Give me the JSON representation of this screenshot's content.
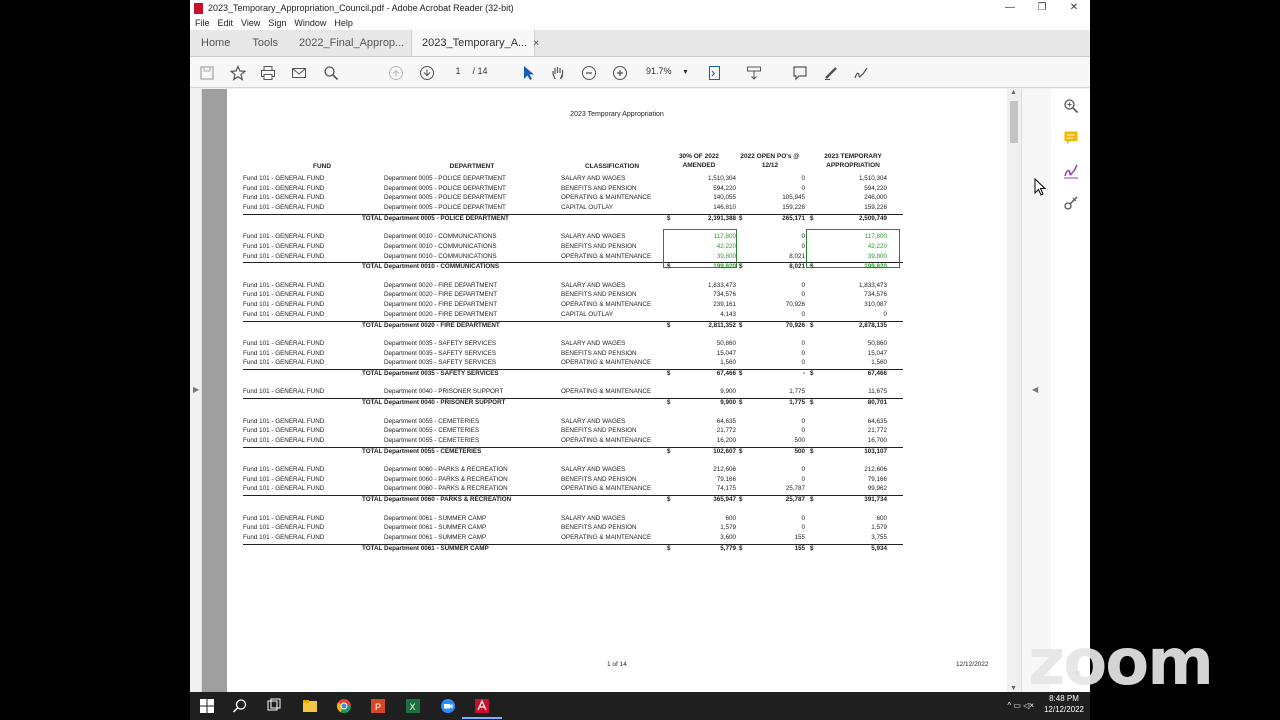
{
  "window": {
    "title": "2023_Temporary_Appropriation_Council.pdf - Adobe Acrobat Reader (32-bit)",
    "minimize": "—",
    "maximize": "❐",
    "close": "✕"
  },
  "menu": [
    "File",
    "Edit",
    "View",
    "Sign",
    "Window",
    "Help"
  ],
  "tabs": {
    "home": "Home",
    "tools": "Tools",
    "doc1": "2022_Final_Approp...",
    "doc2": "2023_Temporary_A...",
    "close": "×"
  },
  "toolbar": {
    "page_current": "1",
    "page_total": "/ 14",
    "zoom": "91.7%",
    "icons": [
      "save-icon",
      "bookmark-star-icon",
      "print-icon",
      "email-icon",
      "search-icon",
      "page-up-icon",
      "page-down-icon",
      "select-cursor-icon",
      "hand-icon",
      "zoom-out-icon",
      "zoom-in-icon",
      "fit-page-icon",
      "scroll-mode-icon",
      "comment-icon",
      "highlight-icon",
      "sign-icon"
    ]
  },
  "document": {
    "title": "2023 Temporary Appropriation",
    "headers": {
      "fund": "FUND",
      "department": "DEPARTMENT",
      "classification": "CLASSIFICATION",
      "v1_line1": "30% OF 2022",
      "v1_line2": "AMENDED",
      "v2_line1": "2022 OPEN PO's @",
      "v2_line2": "12/12",
      "v3_line1": "2023 TEMPORARY",
      "v3_line2": "APPROPRIATION"
    },
    "groups": [
      {
        "rows": [
          {
            "fund": "Fund  101 - GENERAL FUND",
            "dept": "Department  0005 - POLICE DEPARTMENT",
            "cls": "SALARY AND WAGES",
            "v1": "1,510,304",
            "v2": "0",
            "v3": "1,510,304"
          },
          {
            "fund": "Fund  101 - GENERAL FUND",
            "dept": "Department  0005 - POLICE DEPARTMENT",
            "cls": "BENEFITS AND PENSION",
            "v1": "594,220",
            "v2": "0",
            "v3": "594,220"
          },
          {
            "fund": "Fund  101 - GENERAL FUND",
            "dept": "Department  0005 - POLICE DEPARTMENT",
            "cls": "OPERATING & MAINTENANCE",
            "v1": "140,055",
            "v2": "105,945",
            "v3": "246,000"
          },
          {
            "fund": "Fund  101 - GENERAL FUND",
            "dept": "Department  0005 - POLICE DEPARTMENT",
            "cls": "CAPITAL OUTLAY",
            "v1": "146,810",
            "v2": "159,226",
            "v3": "159,226"
          }
        ],
        "total": {
          "label": "TOTAL Department  0005 - POLICE DEPARTMENT",
          "v1": "2,391,388",
          "v2": "265,171",
          "v3": "2,509,749"
        }
      },
      {
        "rows": [
          {
            "fund": "Fund  101 - GENERAL FUND",
            "dept": "Department  0010 - COMMUNICATIONS",
            "cls": "SALARY AND WAGES",
            "v1": "117,800",
            "v2": "0",
            "v3": "117,800"
          },
          {
            "fund": "Fund  101 - GENERAL FUND",
            "dept": "Department  0010 - COMMUNICATIONS",
            "cls": "BENEFITS AND PENSION",
            "v1": "42,220",
            "v2": "0",
            "v3": "42,220"
          },
          {
            "fund": "Fund  101 - GENERAL FUND",
            "dept": "Department  0010 - COMMUNICATIONS",
            "cls": "OPERATING & MAINTENANCE",
            "v1": "39,800",
            "v2": "8,021",
            "v3": "39,800"
          }
        ],
        "total": {
          "label": "TOTAL Department  0010 - COMMUNICATIONS",
          "v1": "199,820",
          "v2": "8,021",
          "v3": "199,820"
        }
      },
      {
        "rows": [
          {
            "fund": "Fund  101 - GENERAL FUND",
            "dept": "Department  0020 - FIRE DEPARTMENT",
            "cls": "SALARY AND WAGES",
            "v1": "1,833,473",
            "v2": "0",
            "v3": "1,833,473"
          },
          {
            "fund": "Fund  101 - GENERAL FUND",
            "dept": "Department  0020 - FIRE DEPARTMENT",
            "cls": "BENEFITS AND PENSION",
            "v1": "734,576",
            "v2": "0",
            "v3": "734,576"
          },
          {
            "fund": "Fund  101 - GENERAL FUND",
            "dept": "Department  0020 - FIRE DEPARTMENT",
            "cls": "OPERATING & MAINTENANCE",
            "v1": "239,161",
            "v2": "70,926",
            "v3": "310,087"
          },
          {
            "fund": "Fund  101 - GENERAL FUND",
            "dept": "Department  0020 - FIRE DEPARTMENT",
            "cls": "CAPITAL OUTLAY",
            "v1": "4,143",
            "v2": "0",
            "v3": "0"
          }
        ],
        "total": {
          "label": "TOTAL Department  0020 - FIRE DEPARTMENT",
          "v1": "2,811,352",
          "v2": "70,926",
          "v3": "2,878,135"
        }
      },
      {
        "rows": [
          {
            "fund": "Fund  101 - GENERAL FUND",
            "dept": "Department  0035 - SAFETY SERVICES",
            "cls": "SALARY AND WAGES",
            "v1": "50,860",
            "v2": "0",
            "v3": "50,860"
          },
          {
            "fund": "Fund  101 - GENERAL FUND",
            "dept": "Department  0035 - SAFETY SERVICES",
            "cls": "BENEFITS AND PENSION",
            "v1": "15,047",
            "v2": "0",
            "v3": "15,047"
          },
          {
            "fund": "Fund  101 - GENERAL FUND",
            "dept": "Department  0035 - SAFETY SERVICES",
            "cls": "OPERATING & MAINTENANCE",
            "v1": "1,560",
            "v2": "0",
            "v3": "1,560"
          }
        ],
        "total": {
          "label": "TOTAL Department  0035 - SAFETY SERVICES",
          "v1": "67,466",
          "v2": "-",
          "v3": "67,466"
        }
      },
      {
        "rows": [
          {
            "fund": "Fund  101 - GENERAL FUND",
            "dept": "Department  0040 - PRISONER SUPPORT",
            "cls": "OPERATING & MAINTENANCE",
            "v1": "9,900",
            "v2": "1,775",
            "v3": "11,675"
          }
        ],
        "total": {
          "label": "TOTAL Department  0040 - PRISONER SUPPORT",
          "v1": "9,900",
          "v2": "1,775",
          "v3": "80,701"
        }
      },
      {
        "rows": [
          {
            "fund": "Fund  101 - GENERAL FUND",
            "dept": "Department  0055 - CEMETERIES",
            "cls": "SALARY AND WAGES",
            "v1": "64,635",
            "v2": "0",
            "v3": "64,635"
          },
          {
            "fund": "Fund  101 - GENERAL FUND",
            "dept": "Department  0055 - CEMETERIES",
            "cls": "BENEFITS AND PENSION",
            "v1": "21,772",
            "v2": "0",
            "v3": "21,772"
          },
          {
            "fund": "Fund  101 - GENERAL FUND",
            "dept": "Department  0055 - CEMETERIES",
            "cls": "OPERATING & MAINTENANCE",
            "v1": "16,200",
            "v2": "500",
            "v3": "16,700"
          }
        ],
        "total": {
          "label": "TOTAL Department  0055 - CEMETERIES",
          "v1": "102,607",
          "v2": "500",
          "v3": "103,107"
        }
      },
      {
        "rows": [
          {
            "fund": "Fund  101 - GENERAL FUND",
            "dept": "Department  0060 - PARKS & RECREATION",
            "cls": "SALARY AND WAGES",
            "v1": "212,606",
            "v2": "0",
            "v3": "212,606"
          },
          {
            "fund": "Fund  101 - GENERAL FUND",
            "dept": "Department  0060 - PARKS & RECREATION",
            "cls": "BENEFITS AND PENSION",
            "v1": "79,166",
            "v2": "0",
            "v3": "79,166"
          },
          {
            "fund": "Fund  101 - GENERAL FUND",
            "dept": "Department  0060 - PARKS & RECREATION",
            "cls": "OPERATING & MAINTENANCE",
            "v1": "74,175",
            "v2": "25,787",
            "v3": "99,962"
          }
        ],
        "total": {
          "label": "TOTAL Department  0060 - PARKS & RECREATION",
          "v1": "365,947",
          "v2": "25,787",
          "v3": "391,734"
        }
      },
      {
        "rows": [
          {
            "fund": "Fund  101 - GENERAL FUND",
            "dept": "Department  0061 - SUMMER CAMP",
            "cls": "SALARY AND WAGES",
            "v1": "600",
            "v2": "0",
            "v3": "600"
          },
          {
            "fund": "Fund  101 - GENERAL FUND",
            "dept": "Department  0061 - SUMMER CAMP",
            "cls": "BENEFITS AND PENSION",
            "v1": "1,579",
            "v2": "0",
            "v3": "1,579"
          },
          {
            "fund": "Fund  101 - GENERAL FUND",
            "dept": "Department  0061 - SUMMER CAMP",
            "cls": "OPERATING & MAINTENANCE",
            "v1": "3,600",
            "v2": "155",
            "v3": "3,755"
          }
        ],
        "total": {
          "label": "TOTAL Department  0061 - SUMMER CAMP",
          "v1": "5,779",
          "v2": "155",
          "v3": "5,934"
        }
      }
    ],
    "currency": "$",
    "footer_page": "1 of 14",
    "footer_date": "12/12/2022"
  },
  "overlay": {
    "logo_text": "zoom"
  },
  "taskbar": {
    "time": "8:48 PM",
    "date": "12/12/2022",
    "icons": [
      "windows-start-icon",
      "search-icon",
      "task-view-icon",
      "file-explorer-icon",
      "chrome-icon",
      "powerpoint-icon",
      "excel-icon",
      "zoom-app-icon",
      "acrobat-icon"
    ]
  },
  "colors": {
    "accent_green": "#2a9d2a",
    "acrobat_red": "#c8102e",
    "taskbar": "#1f1f1f"
  }
}
